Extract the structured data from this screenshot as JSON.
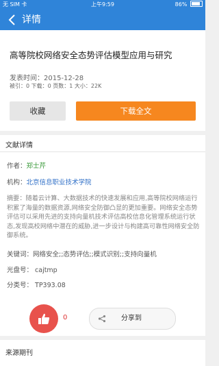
{
  "status_bar": {
    "carrier": "无 SIM 卡",
    "time": "上午9:59",
    "battery": "86%",
    "battery_level": 0.86
  },
  "nav": {
    "title": "详情",
    "back_icon": "chevron-left-icon"
  },
  "article": {
    "title": "高等院校网络安全态势评估模型应用与研究",
    "publish_date": "发表时间：2015-12-28",
    "stats": "被引：0  下载：0  页数：1  大小：22K"
  },
  "actions": {
    "favorite_label": "收藏",
    "download_label": "下载全文"
  },
  "details": {
    "section_title": "文献详情",
    "author_label": "作者：",
    "author": "郑士芹",
    "org_label": "机构：",
    "org": "北京信息职业技术学院",
    "abstract": "摘要：随着云计算、大数据技术的快速发展和应用,高等院校网络运行积累了海量的数据资源,网络安全防御凸显的更加重要。网络安全态势评估可以采用先进的支持向量机技术评估高校信息化管理系统运行状态,发现高校网络中潜在的威胁,进一步设计与构建高可靠性网络安全防御系统。",
    "keywords": "关键词：网络安全;;态势评估;;模式识别;;支持向量机",
    "disc": "光盘号：  cajtmp",
    "classification": "分类号：  TP393.08",
    "like_count": "0",
    "share_label": "分享到"
  },
  "source": {
    "section_title": "来源期刊"
  },
  "colors": {
    "primary": "#2f84d9",
    "download": "#f6871f",
    "like": "#e8524c",
    "author": "#3a9a3a",
    "org": "#2f6fc7"
  }
}
